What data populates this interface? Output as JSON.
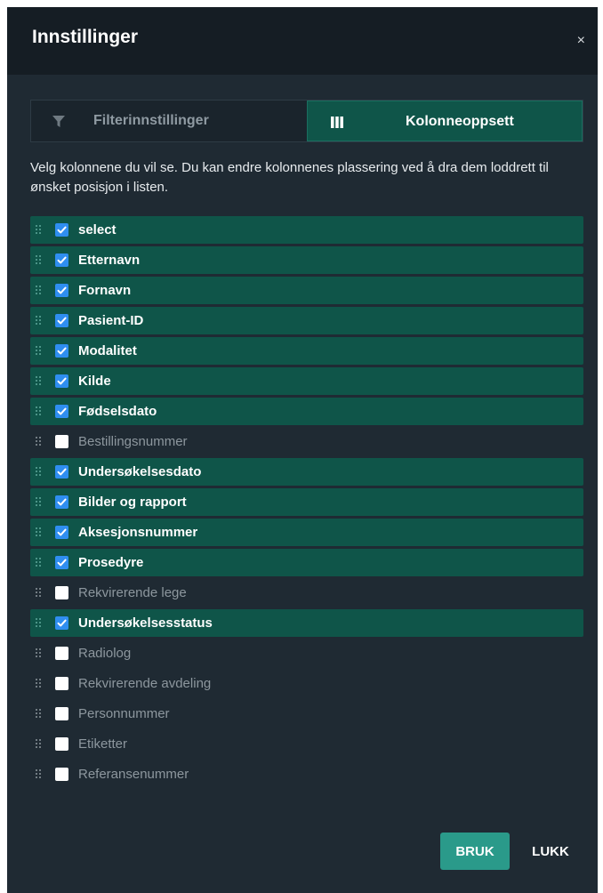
{
  "dialog": {
    "title": "Innstillinger",
    "close_symbol": "×"
  },
  "tabs": [
    {
      "label": "Filterinnstillinger",
      "icon": "filter-icon",
      "active": false
    },
    {
      "label": "Kolonneoppsett",
      "icon": "columns-icon",
      "active": true
    }
  ],
  "description": "Velg kolonnene du vil se. Du kan endre kolonnenes plassering ved å dra dem loddrett til ønsket posisjon i listen.",
  "columns": [
    {
      "label": "select",
      "checked": true
    },
    {
      "label": "Etternavn",
      "checked": true
    },
    {
      "label": "Fornavn",
      "checked": true
    },
    {
      "label": "Pasient-ID",
      "checked": true
    },
    {
      "label": "Modalitet",
      "checked": true
    },
    {
      "label": "Kilde",
      "checked": true
    },
    {
      "label": "Fødselsdato",
      "checked": true
    },
    {
      "label": "Bestillingsnummer",
      "checked": false
    },
    {
      "label": "Undersøkelsesdato",
      "checked": true
    },
    {
      "label": "Bilder og rapport",
      "checked": true
    },
    {
      "label": "Aksesjonsnummer",
      "checked": true
    },
    {
      "label": "Prosedyre",
      "checked": true
    },
    {
      "label": "Rekvirerende lege",
      "checked": false
    },
    {
      "label": "Undersøkelsesstatus",
      "checked": true
    },
    {
      "label": "Radiolog",
      "checked": false
    },
    {
      "label": "Rekvirerende avdeling",
      "checked": false
    },
    {
      "label": "Personnummer",
      "checked": false
    },
    {
      "label": "Etiketter",
      "checked": false
    },
    {
      "label": "Referansenummer",
      "checked": false
    }
  ],
  "footer": {
    "apply_label": "BRUK",
    "close_label": "LUKK"
  },
  "colors": {
    "dialog_bg": "#1f2a33",
    "header_bg": "#151d24",
    "active_row": "#0f5549",
    "checkbox_blue": "#2f8ef0",
    "apply_button": "#2a9a8a"
  }
}
